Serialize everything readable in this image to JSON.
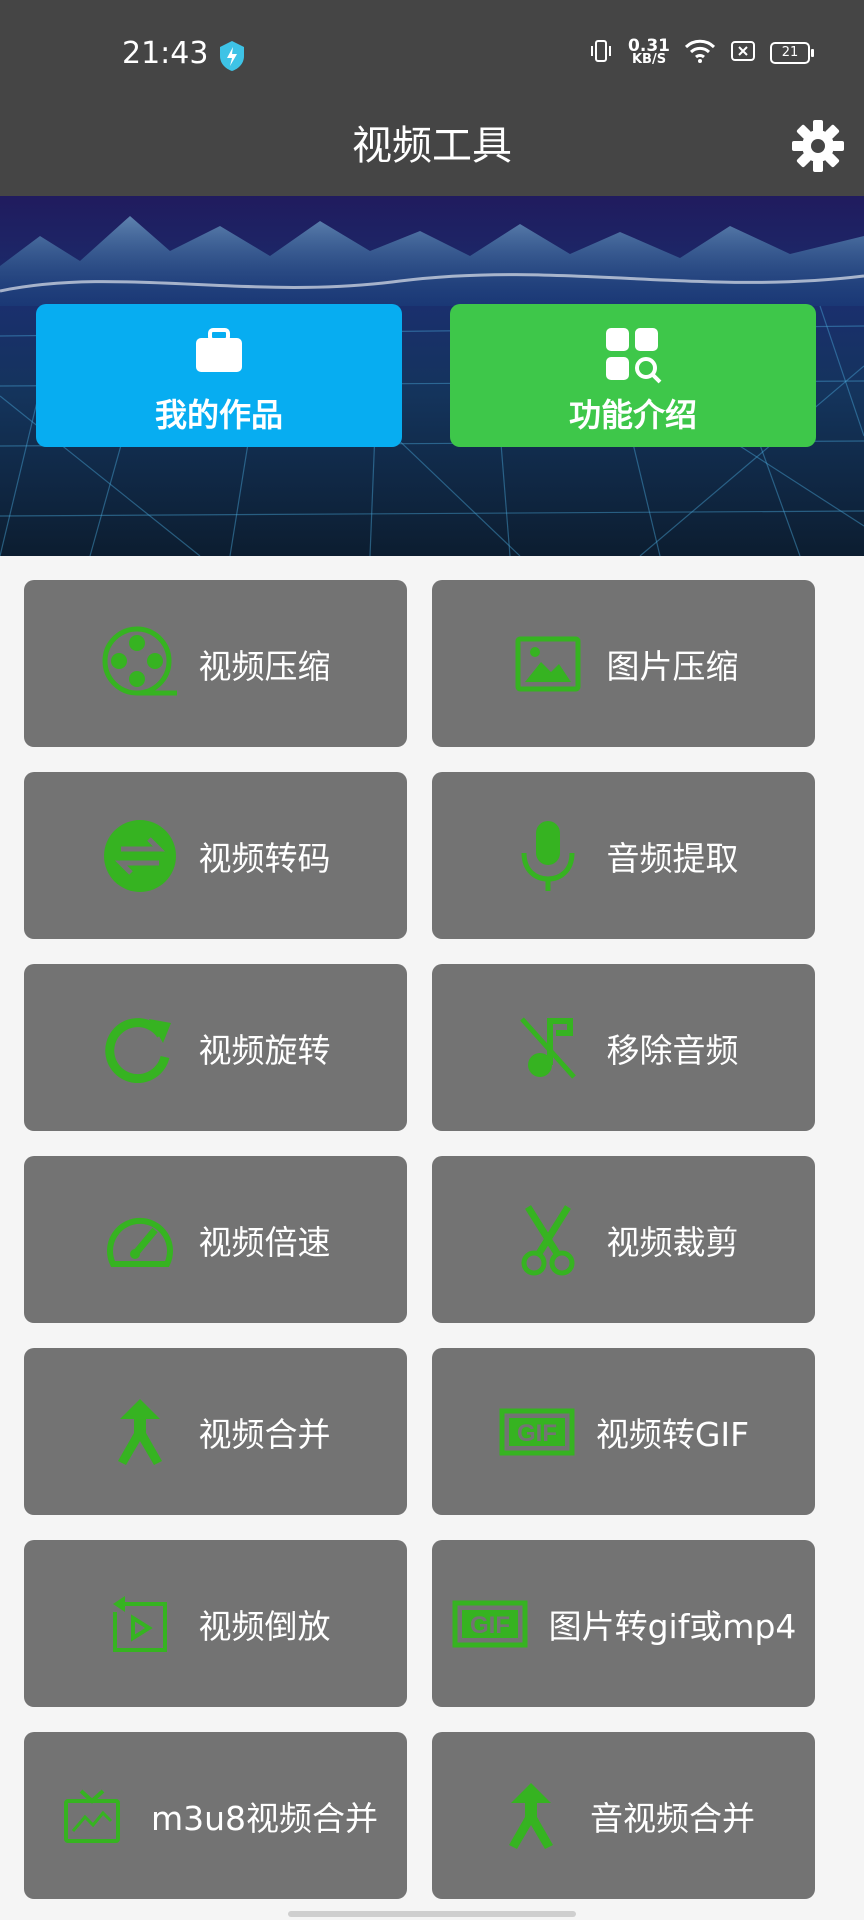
{
  "status_bar": {
    "time": "21:43",
    "net_speed_value": "0.31",
    "net_speed_unit": "KB/S",
    "battery": "21"
  },
  "app_bar": {
    "title": "视频工具"
  },
  "banner": {
    "works_label": "我的作品",
    "intro_label": "功能介绍"
  },
  "colors": {
    "bar": "#454545",
    "accent_green": "#3ec74a",
    "accent_blue": "#07adf1",
    "tile": "#737373",
    "icon_green": "#36b321"
  },
  "tools": [
    {
      "label": "视频压缩",
      "icon": "film-reel-icon"
    },
    {
      "label": "图片压缩",
      "icon": "image-icon"
    },
    {
      "label": "视频转码",
      "icon": "swap-arrows-icon"
    },
    {
      "label": "音频提取",
      "icon": "microphone-icon"
    },
    {
      "label": "视频旋转",
      "icon": "rotate-icon"
    },
    {
      "label": "移除音频",
      "icon": "music-off-icon"
    },
    {
      "label": "视频倍速",
      "icon": "speedometer-icon"
    },
    {
      "label": "视频裁剪",
      "icon": "scissors-icon"
    },
    {
      "label": "视频合并",
      "icon": "merge-icon"
    },
    {
      "label": "视频转GIF",
      "icon": "gif-icon"
    },
    {
      "label": "视频倒放",
      "icon": "reverse-play-icon"
    },
    {
      "label": "图片转gif或mp4",
      "icon": "gif-icon"
    },
    {
      "label": "m3u8视频合并",
      "icon": "tv-icon"
    },
    {
      "label": "音视频合并",
      "icon": "merge-icon"
    }
  ]
}
